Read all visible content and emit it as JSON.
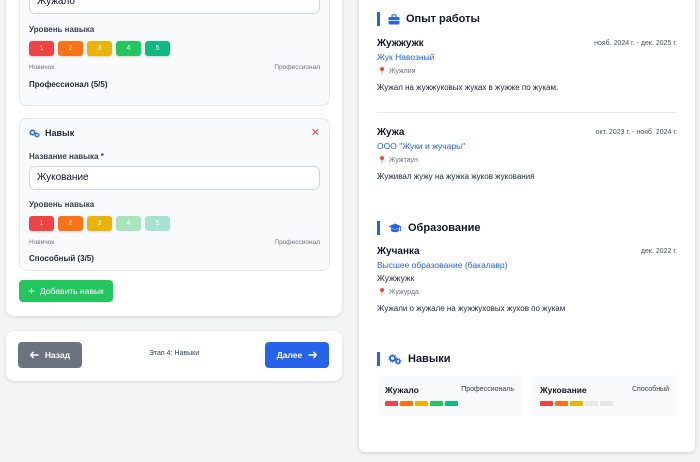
{
  "form": {
    "skill1": {
      "name_value": "Жужало",
      "level_label": "Уровень навыка",
      "levels": [
        "1",
        "2",
        "3",
        "4",
        "5"
      ],
      "scale_min": "Новичок",
      "scale_max": "Профессионал",
      "level_text": "Профессионал (5/5)",
      "level_value": 5
    },
    "skill2": {
      "header": "Навык",
      "name_label": "Название навыка *",
      "name_value": "Жукование",
      "level_label": "Уровень навыка",
      "levels": [
        "1",
        "2",
        "3",
        "4",
        "5"
      ],
      "scale_min": "Новичок",
      "scale_max": "Профессионал",
      "level_text": "Способный (3/5)",
      "level_value": 3
    },
    "add_skill_label": "Добавить навык"
  },
  "nav": {
    "back_label": "Назад",
    "step_text": "Этап 4: Навыки",
    "next_label": "Далее"
  },
  "preview": {
    "experience": {
      "title": "Опыт работы",
      "entries": [
        {
          "position": "Жужжужк",
          "company": "Жук Навозный",
          "dates": "нояб. 2024 г. - дек. 2025 г.",
          "location": "Жужлия",
          "description": "Жужал на жужжуковых жуках в жужже по жукам."
        },
        {
          "position": "Жужа",
          "company": "ООО \"Жуки и жучары\"",
          "dates": "окт. 2023 г. - нояб. 2024 г.",
          "location": "Жужтаун",
          "description": "Жуживал жужу на жужка жуков жукования"
        }
      ]
    },
    "education": {
      "title": "Образование",
      "entries": [
        {
          "institution": "Жучанка",
          "degree": "Высшее образование (бакалавр)",
          "field": "Жужжужк",
          "date": "дек. 2022 г.",
          "location": "Жужурда",
          "description": "Жужали о жужале на жужжуховых жухов по жукам"
        }
      ]
    },
    "skills": {
      "title": "Навыки",
      "items": [
        {
          "name": "Жужало",
          "level": "Профессиональ",
          "value": 5
        },
        {
          "name": "Жукование",
          "level": "Способный",
          "value": 3
        }
      ]
    }
  },
  "colors": {
    "level_1": "#ef4444",
    "level_2": "#f97316",
    "level_3": "#eab308",
    "level_4": "#22c55e",
    "level_5": "#10b981",
    "accent": "#2563eb"
  }
}
